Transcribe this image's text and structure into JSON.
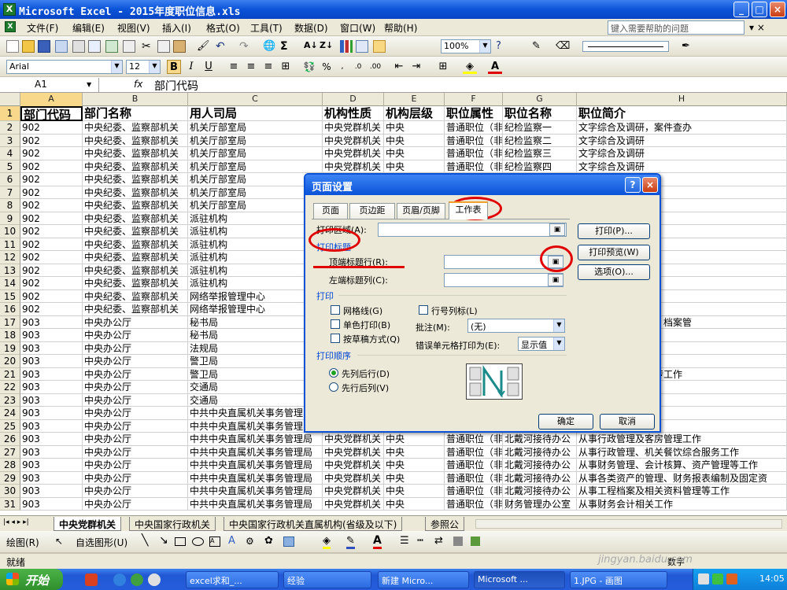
{
  "window": {
    "title": "Microsoft Excel - 2015年度职位信息.xls"
  },
  "menu": [
    "文件(F)",
    "编辑(E)",
    "视图(V)",
    "插入(I)",
    "格式(O)",
    "工具(T)",
    "数据(D)",
    "窗口(W)",
    "帮助(H)"
  ],
  "help_placeholder": "键入需要帮助的问题",
  "toolbar": {
    "zoom": "100%",
    "font": "Arial",
    "size": "12"
  },
  "formula": {
    "cell": "A1",
    "fx": "fx",
    "value": "部门代码"
  },
  "columns": [
    "A",
    "B",
    "C",
    "D",
    "E",
    "F",
    "G",
    "H"
  ],
  "rows": [
    [
      "部门代码",
      "部门名称",
      "用人司局",
      "机构性质",
      "机构层级",
      "职位属性",
      "职位名称",
      "职位简介"
    ],
    [
      "902",
      "中央纪委、监察部机关",
      "机关厅部室局",
      "中央党群机关",
      "中央",
      "普通职位（非",
      "纪检监察一",
      "文字综合及调研，案件查办"
    ],
    [
      "902",
      "中央纪委、监察部机关",
      "机关厅部室局",
      "中央党群机关",
      "中央",
      "普通职位（非",
      "纪检监察二",
      "文字综合及调研"
    ],
    [
      "902",
      "中央纪委、监察部机关",
      "机关厅部室局",
      "中央党群机关",
      "中央",
      "普通职位（非",
      "纪检监察三",
      "文字综合及调研"
    ],
    [
      "902",
      "中央纪委、监察部机关",
      "机关厅部室局",
      "中央党群机关",
      "中央",
      "普通职位（非",
      "纪检监察四",
      "文字综合及调研"
    ],
    [
      "902",
      "中央纪委、监察部机关",
      "机关厅部室局",
      "",
      "",
      "",
      "",
      "办"
    ],
    [
      "902",
      "中央纪委、监察部机关",
      "机关厅部室局",
      "",
      "",
      "",
      "",
      ""
    ],
    [
      "902",
      "中央纪委、监察部机关",
      "机关厅部室局",
      "",
      "",
      "",
      "",
      ""
    ],
    [
      "902",
      "中央纪委、监察部机关",
      "派驻机构",
      "",
      "",
      "",
      "",
      ""
    ],
    [
      "902",
      "中央纪委、监察部机关",
      "派驻机构",
      "",
      "",
      "",
      "",
      ""
    ],
    [
      "902",
      "中央纪委、监察部机关",
      "派驻机构",
      "",
      "",
      "",
      "",
      ""
    ],
    [
      "902",
      "中央纪委、监察部机关",
      "派驻机构",
      "",
      "",
      "",
      "",
      ""
    ],
    [
      "902",
      "中央纪委、监察部机关",
      "派驻机构",
      "",
      "",
      "",
      "",
      ""
    ],
    [
      "902",
      "中央纪委、监察部机关",
      "派驻机构",
      "",
      "",
      "",
      "",
      ""
    ],
    [
      "902",
      "中央纪委、监察部机关",
      "网络举报管理中心",
      "",
      "",
      "",
      "",
      "营维护"
    ],
    [
      "902",
      "中央纪委、监察部机关",
      "网络举报管理中心",
      "",
      "",
      "",
      "",
      ""
    ],
    [
      "903",
      "中央办公厅",
      "秘书局",
      "",
      "",
      "",
      "",
      "字综合、文件分发、档案管"
    ],
    [
      "903",
      "中央办公厅",
      "秘书局",
      "",
      "",
      "",
      "",
      ""
    ],
    [
      "903",
      "中央办公厅",
      "法规局",
      "",
      "",
      "",
      "",
      "和机关事务工作"
    ],
    [
      "903",
      "中央办公厅",
      "警卫局",
      "",
      "",
      "",
      "",
      "工作"
    ],
    [
      "903",
      "中央办公厅",
      "警卫局",
      "",
      "",
      "",
      "",
      "图、摄像编辑等宣传工作"
    ],
    [
      "903",
      "中央办公厅",
      "交通局",
      "",
      "",
      "",
      "",
      "营业务工作"
    ],
    [
      "903",
      "中央办公厅",
      "交通局",
      "",
      "",
      "",
      "",
      "营业务工作"
    ],
    [
      "903",
      "中央办公厅",
      "中共中央直属机关事务管理",
      "",
      "",
      "",
      "",
      ""
    ],
    [
      "903",
      "中央办公厅",
      "中共中央直属机关事务管理",
      "",
      "",
      "",
      "",
      ""
    ],
    [
      "903",
      "中央办公厅",
      "中共中央直属机关事务管理局",
      "中央党群机关",
      "中央",
      "普通职位（非",
      "北戴河接待办公",
      "从事行政管理及客房管理工作"
    ],
    [
      "903",
      "中央办公厅",
      "中共中央直属机关事务管理局",
      "中央党群机关",
      "中央",
      "普通职位（非",
      "北戴河接待办公",
      "从事行政管理、机关餐饮综合服务工作"
    ],
    [
      "903",
      "中央办公厅",
      "中共中央直属机关事务管理局",
      "中央党群机关",
      "中央",
      "普通职位（非",
      "北戴河接待办公",
      "从事财务管理、会计核算、资产管理等工作"
    ],
    [
      "903",
      "中央办公厅",
      "中共中央直属机关事务管理局",
      "中央党群机关",
      "中央",
      "普通职位（非",
      "北戴河接待办公",
      "从事各类资产的管理、财务报表编制及固定资"
    ],
    [
      "903",
      "中央办公厅",
      "中共中央直属机关事务管理局",
      "中央党群机关",
      "中央",
      "普通职位（非",
      "北戴河接待办公",
      "从事工程档案及相关资料管理等工作"
    ],
    [
      "903",
      "中央办公厅",
      "中共中央直属机关事务管理局",
      "中央党群机关",
      "中央",
      "普通职位（非",
      "财务管理办公室",
      "从事财务会计相关工作"
    ]
  ],
  "dialog": {
    "title": "页面设置",
    "tabs": [
      "页面",
      "页边距",
      "页眉/页脚",
      "工作表"
    ],
    "print_area": "打印区域(A):",
    "print_titles": "打印标题",
    "top_rows": "顶端标题行(R):",
    "left_cols": "左端标题列(C):",
    "print_group": "打印",
    "gridlines": "网格线(G)",
    "bw": "单色打印(B)",
    "draft": "按草稿方式(Q)",
    "rowcol": "行号列标(L)",
    "comments": "批注(M):",
    "comments_val": "(无)",
    "errors": "错误单元格打印为(E):",
    "errors_val": "显示值",
    "order_group": "打印顺序",
    "down_over": "先列后行(D)",
    "over_down": "先行后列(V)",
    "btn_print": "打印(P)...",
    "btn_preview": "打印预览(W)",
    "btn_options": "选项(O)...",
    "btn_ok": "确定",
    "btn_cancel": "取消"
  },
  "sheets": [
    "中央党群机关",
    "中央国家行政机关",
    "中央国家行政机关直属机构(省级及以下)",
    "参照公"
  ],
  "draw": {
    "label": "绘图(R)",
    "autoshape": "自选图形(U)"
  },
  "status": {
    "ready": "就绪",
    "num": "数字"
  },
  "taskbar": {
    "start": "开始",
    "items": [
      "excel求和_...",
      "经验",
      "新建 Micro...",
      "Microsoft ...",
      "1.JPG - 画图"
    ],
    "clock": "14:05"
  },
  "watermark": "jingyan.baidu.com"
}
